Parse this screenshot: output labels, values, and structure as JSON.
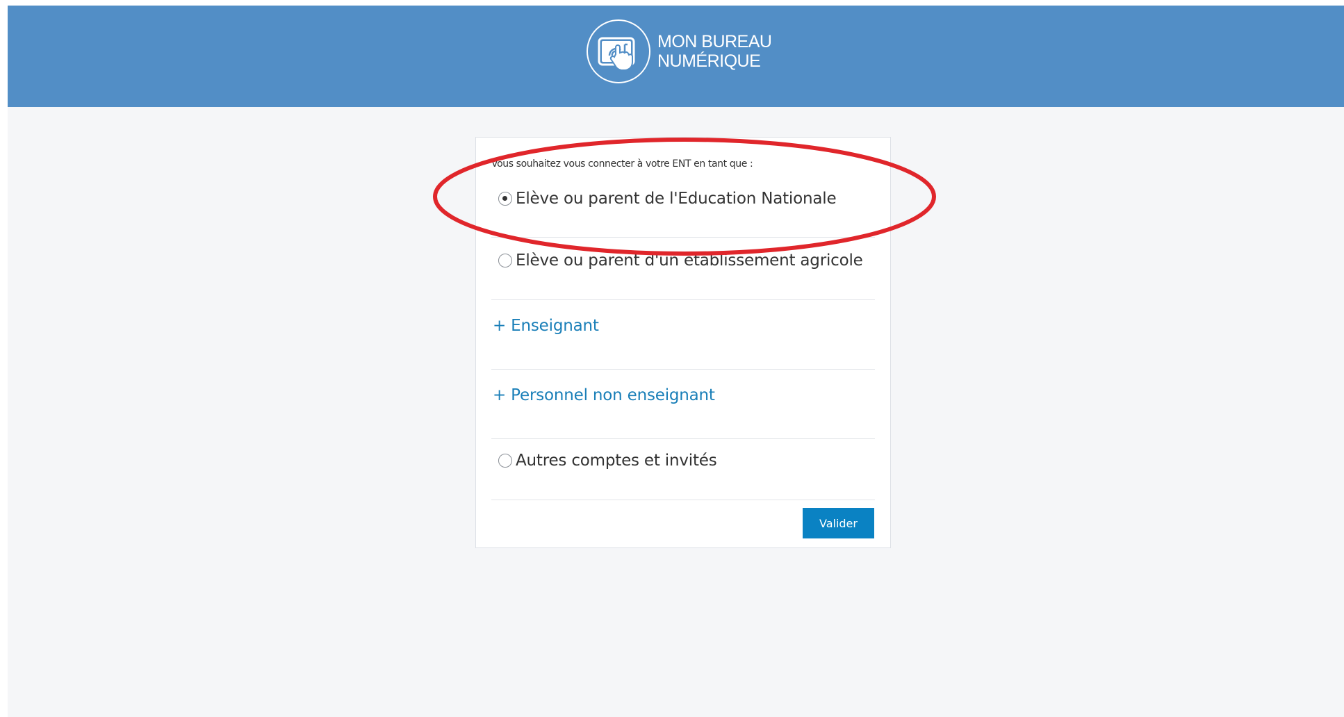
{
  "header": {
    "logo_line1": "MON BUREAU",
    "logo_line2": "NUMÉRIQUE",
    "logo_icon": "tablet-touch-icon"
  },
  "form": {
    "intro": "Vous souhaitez vous connecter à votre ENT en tant que :",
    "options": [
      {
        "label": "Elève ou parent de l'Education Nationale",
        "checked": true
      },
      {
        "label": "Elève ou parent d'un établissement agricole",
        "checked": false
      }
    ],
    "links": [
      {
        "label": "+ Enseignant"
      },
      {
        "label": "+ Personnel non enseignant"
      }
    ],
    "other_option": {
      "label": "Autres comptes et invités",
      "checked": false
    },
    "submit_label": "Valider"
  },
  "colors": {
    "header_bg": "#528ec6",
    "link": "#1a7fb8",
    "button": "#0a82c3",
    "annotation": "#e0262b"
  }
}
